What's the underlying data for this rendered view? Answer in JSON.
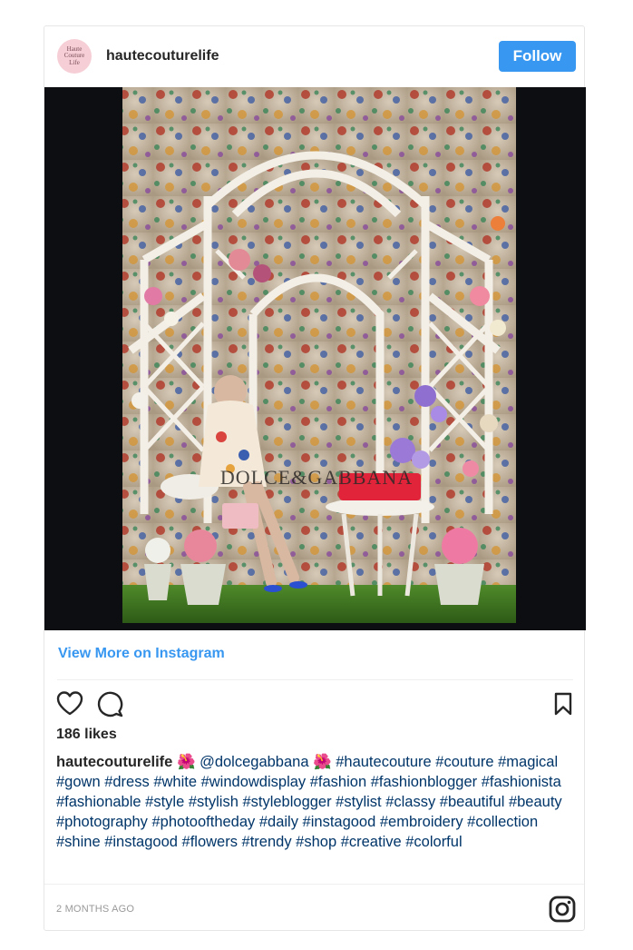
{
  "post": {
    "username": "hautecouturelife",
    "avatar_text": [
      "Haute",
      "Couture",
      "Life"
    ],
    "follow_label": "Follow",
    "image_sign_text": "DOLCE&GABBANA",
    "view_more_label": "View More on Instagram",
    "likes_text": "186 likes",
    "caption_user": "hautecouturelife",
    "caption_text": "🌺 @dolcegabbana 🌺 #hautecouture #couture #magical #gown #dress #white #windowdisplay #fashion #fashionblogger #fashionista #fashionable #style #stylish #styleblogger #stylist #classy #beautiful #beauty #photography #photooftheday #daily #instagood #embroidery #collection #shine #instagood #flowers #trendy #shop #creative #colorful",
    "timestamp": "2 MONTHS AGO"
  },
  "icons": {
    "like": "heart-icon",
    "comment": "comment-icon",
    "save": "bookmark-icon",
    "brand": "instagram-icon"
  },
  "colors": {
    "follow_button": "#3897f0",
    "link": "#3897f0",
    "hashtag": "#003569"
  }
}
